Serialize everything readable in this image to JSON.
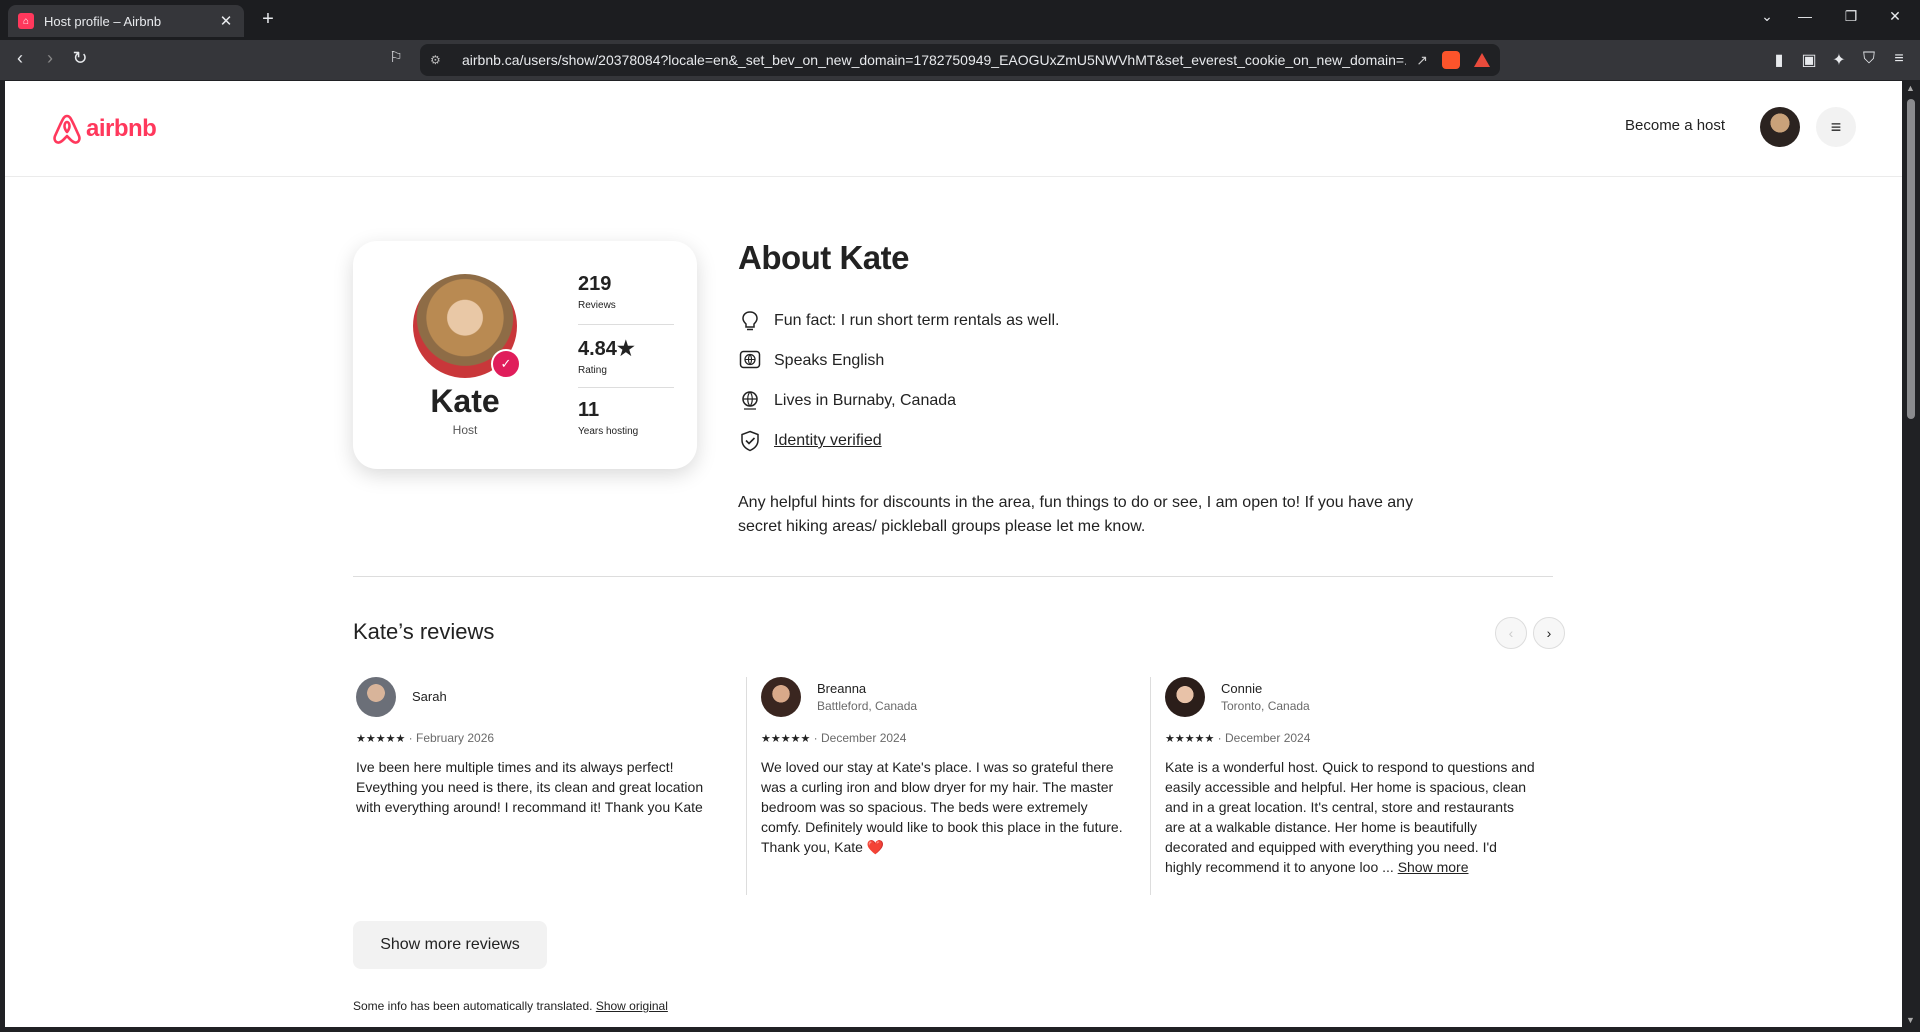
{
  "browser": {
    "tab_title": "Host profile – Airbnb",
    "tab_close": "✕",
    "new_tab": "+",
    "url": "airbnb.ca/users/show/20378084?locale=en&_set_bev_on_new_domain=1782750949_EAOGUxZmU5NWVhMT&set_everest_cookie_on_new_domain=..."
  },
  "header": {
    "logo_text": "airbnb",
    "become_host": "Become a host",
    "menu_icon": "≡"
  },
  "profile": {
    "name": "Kate",
    "role": "Host",
    "stats": [
      {
        "value": "219",
        "label": "Reviews"
      },
      {
        "value": "4.84★",
        "label": "Rating"
      },
      {
        "value": "11",
        "label": "Years hosting"
      }
    ]
  },
  "about": {
    "title": "About Kate",
    "facts": [
      {
        "icon": "lightbulb-icon",
        "text": "Fun fact: I run short term rentals as well."
      },
      {
        "icon": "speech-globe-icon",
        "text": "Speaks English"
      },
      {
        "icon": "globe-icon",
        "text": "Lives in Burnaby, Canada"
      },
      {
        "icon": "shield-check-icon",
        "text": "Identity verified"
      }
    ],
    "bio": "Any helpful hints for discounts in the area, fun things to do or see, I am open to! If you have any secret hiking areas/ pickleball groups please let me know."
  },
  "reviews": {
    "title": "Kate’s reviews",
    "items": [
      {
        "name": "Sarah",
        "location": "",
        "stars": "★★★★★",
        "date": "February 2026",
        "text": "Ive been here multiple times and its always perfect! Eveything you need is there, its clean and great location with everything around! I recommand it! Thank you Kate",
        "more": ""
      },
      {
        "name": "Breanna",
        "location": "Battleford, Canada",
        "stars": "★★★★★",
        "date": "December 2024",
        "text": "We loved our stay at Kate's place. I was so grateful there was a curling iron and blow dryer for my hair. The master bedroom was so spacious. The beds were extremely comfy. Definitely would like to book this place in the future.  Thank you, Kate ❤️",
        "more": ""
      },
      {
        "name": "Connie",
        "location": "Toronto, Canada",
        "stars": "★★★★★",
        "date": "December 2024",
        "text": "Kate is a wonderful host. Quick to respond to questions and easily accessible and helpful. Her home is spacious, clean and in a great location. It's central, store and restaurants are at a walkable distance. Her home is beautifully decorated and equipped with everything you need. I'd highly recommend it to anyone loo ...",
        "more": "Show more"
      }
    ],
    "show_more_button": "Show more reviews"
  },
  "footer_note": {
    "text": "Some info has been automatically translated.",
    "link": "Show original"
  },
  "colors": {
    "brand": "#ff385c",
    "badge": "#e01d5b"
  }
}
